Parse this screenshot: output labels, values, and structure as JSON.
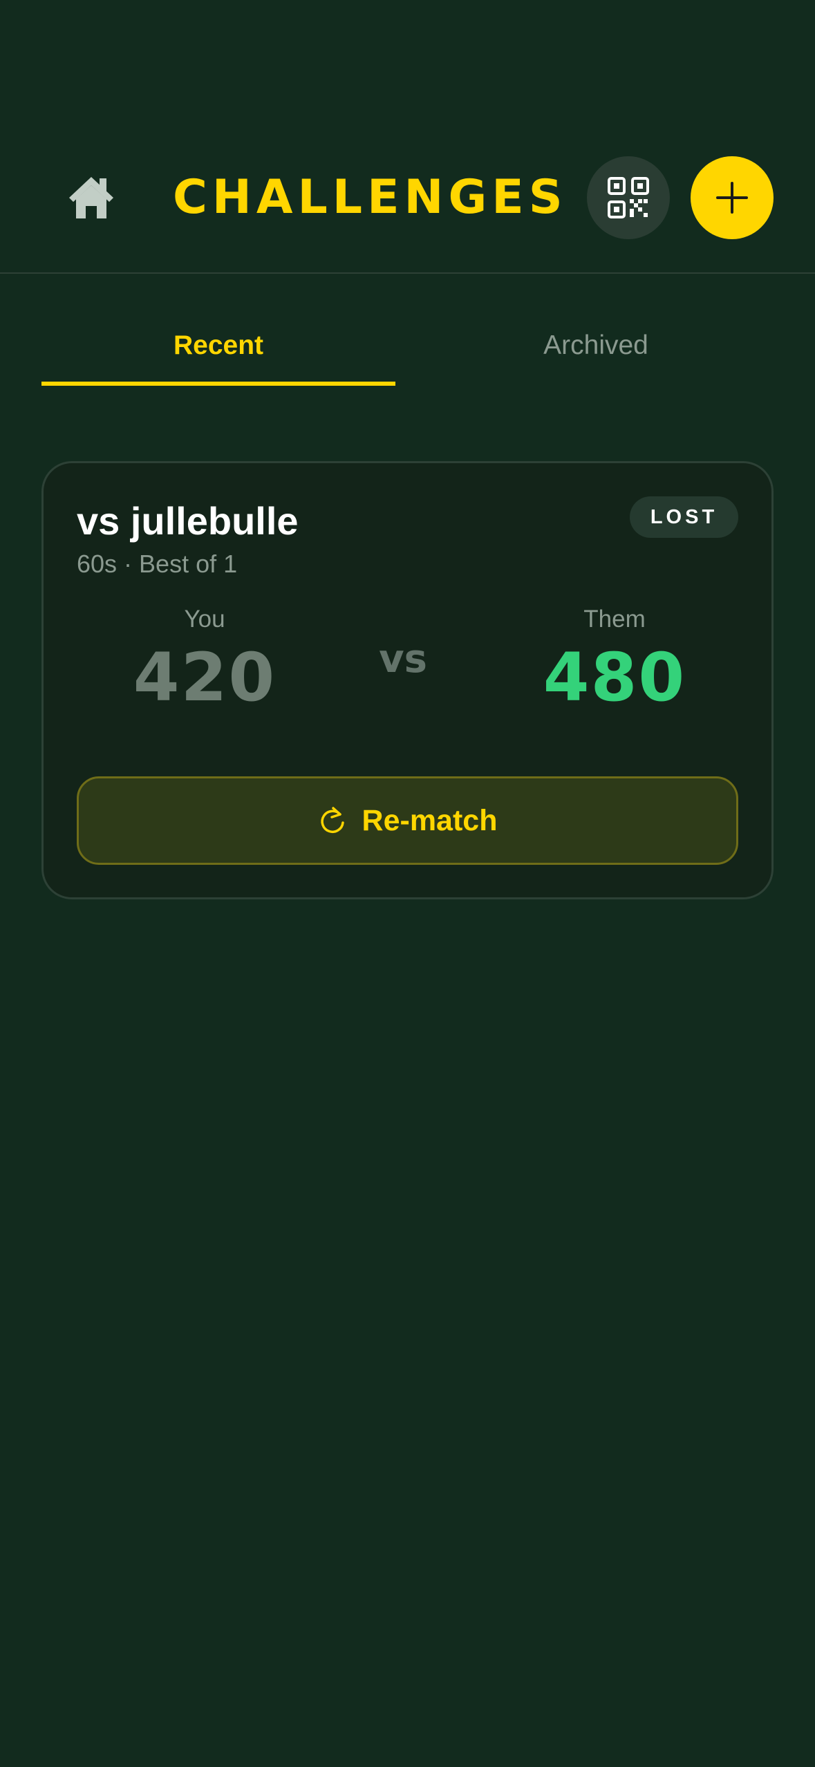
{
  "header": {
    "title": "CHALLENGES",
    "home_icon": "home-icon",
    "qr_icon": "qr-code-icon",
    "add_icon": "plus-icon"
  },
  "tabs": [
    {
      "label": "Recent",
      "active": true
    },
    {
      "label": "Archived",
      "active": false
    }
  ],
  "challenges": [
    {
      "opponent": "vs jullebulle",
      "meta": "60s · Best of 1",
      "status": "LOST",
      "you_label": "You",
      "you_score": "420",
      "vs_label": "vs",
      "them_label": "Them",
      "them_score": "480",
      "action_label": "Re-match",
      "action_icon": "refresh-icon"
    }
  ],
  "colors": {
    "background": "#122b1e",
    "accent": "#ffd600",
    "winner_score": "#34d27a",
    "loser_score": "#6d7d72",
    "muted_text": "#8b9a90",
    "card_border": "#2d4136"
  }
}
